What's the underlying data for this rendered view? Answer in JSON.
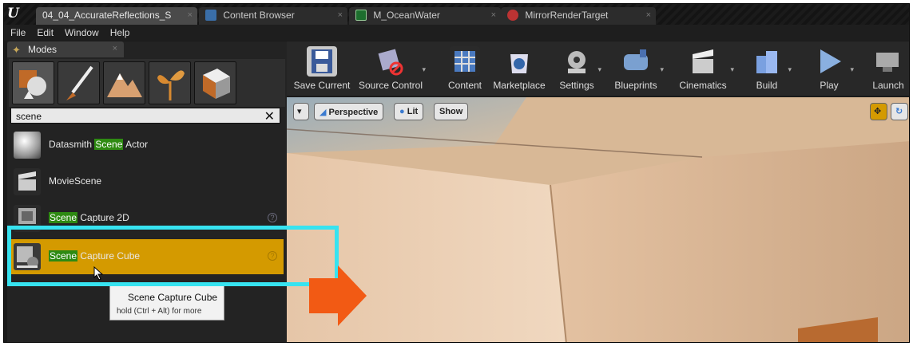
{
  "tabs": [
    {
      "label": "04_04_AccurateReflections_S",
      "active": true
    },
    {
      "label": "Content Browser",
      "active": false,
      "icon": "grid-icon"
    },
    {
      "label": "M_OceanWater",
      "active": false,
      "icon": "material-icon"
    },
    {
      "label": "MirrorRenderTarget",
      "active": false,
      "icon": "texture-icon"
    }
  ],
  "menu": [
    "File",
    "Edit",
    "Window",
    "Help"
  ],
  "modes_panel": {
    "title": "Modes",
    "search_value": "scene",
    "items": [
      {
        "prefix": "Datasmith ",
        "match": "Scene",
        "suffix": " Actor",
        "help": false
      },
      {
        "prefix": "MovieScene",
        "match": "",
        "suffix": "",
        "help": false
      },
      {
        "prefix": "",
        "match": "Scene",
        "suffix": " Capture 2D",
        "help": true
      },
      {
        "prefix": "",
        "match": "Scene",
        "suffix": " Capture Cube",
        "help": true,
        "selected": true
      }
    ],
    "help_glyph": "?",
    "tooltip": {
      "title": "Scene Capture Cube",
      "hint": "hold (Ctrl + Alt) for more"
    }
  },
  "toolbar": {
    "buttons": [
      "Save Current",
      "Source Control",
      "Content",
      "Marketplace",
      "Settings",
      "Blueprints",
      "Cinematics",
      "Build",
      "Play",
      "Launch"
    ]
  },
  "viewport": {
    "perspective_label": "Perspective",
    "lit_label": "Lit",
    "show_label": "Show"
  },
  "glyphs": {
    "close": "×",
    "clear": "✕",
    "dropdown": "▾"
  },
  "colors": {
    "accent_selected": "#d49a00",
    "highlight": "#2e8a12",
    "callout": "#37e3f0",
    "arrow": "#f25a14"
  }
}
